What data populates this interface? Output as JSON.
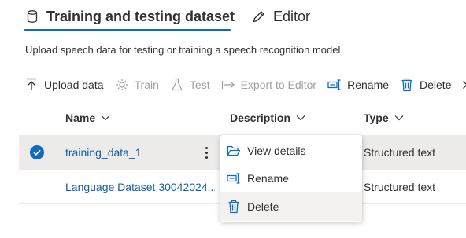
{
  "tabs": [
    {
      "label": "Training and testing dataset",
      "icon": "database-icon",
      "selected": true
    },
    {
      "label": "Editor",
      "icon": "pencil-icon",
      "selected": false
    }
  ],
  "intro_text": "Upload speech data for testing or training a speech recognition model.",
  "toolbar": {
    "upload": {
      "label": "Upload data",
      "icon": "upload-icon",
      "enabled": true
    },
    "train": {
      "label": "Train",
      "icon": "train-icon",
      "enabled": false
    },
    "test": {
      "label": "Test",
      "icon": "flask-icon",
      "enabled": false
    },
    "export": {
      "label": "Export to Editor",
      "icon": "export-arrow-icon",
      "enabled": false
    },
    "rename": {
      "label": "Rename",
      "icon": "rename-icon",
      "enabled": true
    },
    "delete": {
      "label": "Delete",
      "icon": "trash-icon",
      "enabled": true
    }
  },
  "table": {
    "columns": {
      "name": "Name",
      "description": "Description",
      "type": "Type"
    },
    "rows": [
      {
        "name": "training_data_1",
        "type": "Structured text",
        "selected": true
      },
      {
        "name": "Language Dataset 30042024...",
        "type": "Structured text",
        "selected": false
      }
    ]
  },
  "context_menu": {
    "items": [
      {
        "label": "View details",
        "icon": "folder-open-icon"
      },
      {
        "label": "Rename",
        "icon": "rename-icon"
      },
      {
        "label": "Delete",
        "icon": "trash-icon",
        "highlighted": true
      }
    ]
  },
  "colors": {
    "accent": "#0f6cbd",
    "link": "#115ea3",
    "disabled": "#a19f9d",
    "selected_row": "#edebe9"
  }
}
